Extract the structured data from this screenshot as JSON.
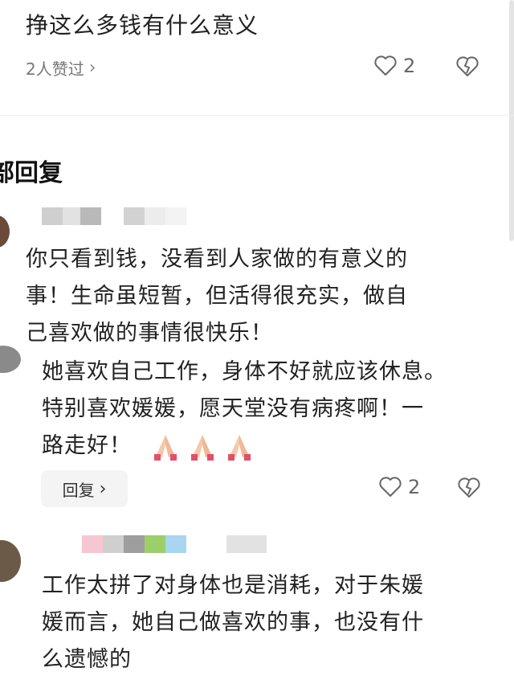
{
  "top_comment": {
    "text": "挣这么多钱有什么意义",
    "likers_label": "2人赞过",
    "like_count": "2"
  },
  "section": {
    "title": "部回复"
  },
  "replies": [
    {
      "text_lines": [
        "你只看到钱，没看到人家做的有意义的",
        "事！生命虽短暂，但活得很充实，做自",
        "己喜欢做的事情很快乐！"
      ]
    },
    {
      "text_lines": [
        "她喜欢自己工作，身体不好就应该休息。",
        "特别喜欢媛媛，愿天堂没有病疼啊！一",
        "路走好！"
      ],
      "reply_label": "回复",
      "like_count": "2"
    },
    {
      "text_lines": [
        "工作太拼了对身体也是消耗，对于朱媛",
        "媛而言，她自己做喜欢的事，也没有什",
        "么遗憾的"
      ]
    }
  ],
  "icons": {
    "heart": "heart-outline-icon",
    "broken_heart": "heart-broken-icon",
    "chevron": "chevron-right-icon",
    "praying_hands": "praying-hands-emoji"
  },
  "colors": {
    "text": "#222222",
    "muted": "#777777",
    "divider": "#ececec",
    "button_bg": "#f4f4f4"
  }
}
